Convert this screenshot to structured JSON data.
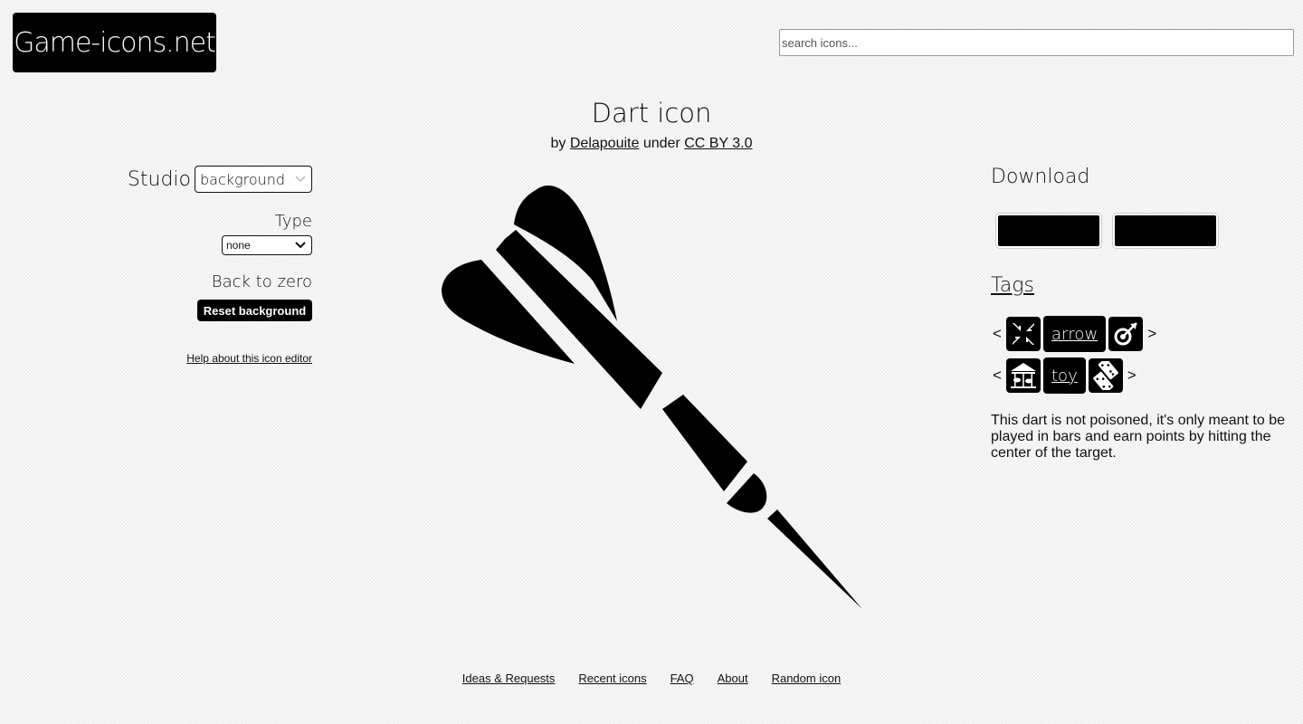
{
  "header": {
    "logo_text": "Game-icons.net",
    "search_placeholder": "search icons..."
  },
  "icon": {
    "title": "Dart icon",
    "by": "by",
    "author": "Delapouite",
    "under": "under",
    "license": "CC BY 3.0"
  },
  "studio": {
    "label": "Studio",
    "mode_selected": "background",
    "type_label": "Type",
    "type_selected": "none",
    "back_to_zero_label": "Back to zero",
    "reset_button": "Reset background",
    "help_link": "Help about this icon editor"
  },
  "download": {
    "title": "Download"
  },
  "tags": {
    "title": "Tags",
    "row1": {
      "prev": "<",
      "left_icon": "shrink-arrows-icon",
      "label": "arrow",
      "right_icon": "arrow-target-icon",
      "next": ">"
    },
    "row2": {
      "prev": "<",
      "left_icon": "carousel-icon",
      "label": "toy",
      "right_icon": "dominoes-icon",
      "next": ">"
    }
  },
  "description": "This dart is not poisoned, it's only meant to be played in bars and earn points by hitting the center of the target.",
  "footer": {
    "links": [
      "Ideas & Requests",
      "Recent icons",
      "FAQ",
      "About",
      "Random icon"
    ]
  },
  "colors": {
    "accent": "#000000",
    "background": "#efefef"
  }
}
